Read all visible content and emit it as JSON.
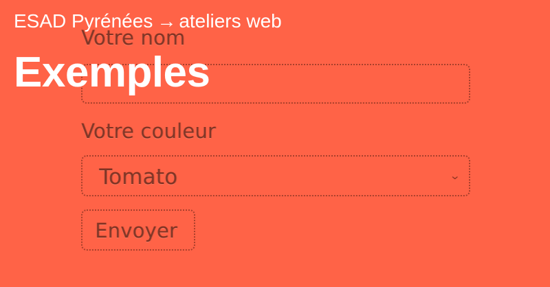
{
  "theme": {
    "background": "#ff6347",
    "text": "#ffffff",
    "ghost": "#3c140a"
  },
  "header": {
    "breadcrumb_site": "ESAD Pyrénées",
    "breadcrumb_arrow": "→",
    "breadcrumb_section": "ateliers web",
    "title": "Exemples"
  },
  "form": {
    "name_label": "Votre nom",
    "name_value": "",
    "color_label": "Votre couleur",
    "color_selected": "Tomato",
    "chevron_icon": "chevron-down-icon",
    "submit_label": "Envoyer"
  }
}
